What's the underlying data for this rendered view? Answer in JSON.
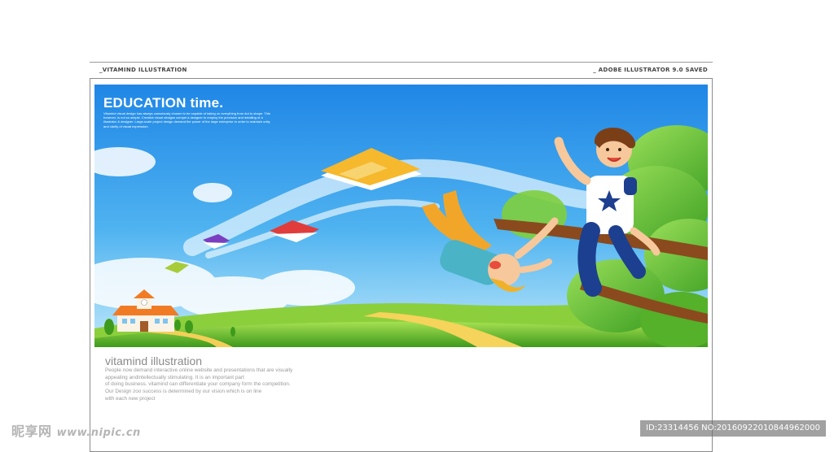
{
  "header": {
    "left_label": "_VITAMIND ILLUSTRATION",
    "right_label": "_ ADOBE ILLUSTRATOR 9.0 SAVED"
  },
  "illustration": {
    "title": "EDUCATION time.",
    "blurb": "Vitamind visual design has always consciously chosen to be capable of taking on everything from dot to shape. This however, is not so simple. Creative visual designs compel a designer to employ the precision and detailing of a illustrator & designer. Large-scale project design demand the power of the large enterprise in order to maintain unity and clarity of visual expression.",
    "colors": {
      "sky_top": "#1f86e6",
      "sky_bottom": "#9fdcf7",
      "grass": "#78c832",
      "path": "#f6d35a",
      "book_yellow": "#f6b82c"
    }
  },
  "footer": {
    "title": "vitamind illustration",
    "lines": [
      "People now demand interactive online website and presentations that are visually",
      "appealing andintellectually stimulating. It is an important part",
      "of doing business. vitamind can differentiate your company form the competition.",
      "Our Design zoo success is determined by our vision which is on line",
      "with each new project"
    ]
  },
  "watermark": {
    "left_brand": "昵享网",
    "left_site": "www.nipic.cn",
    "right_id": "ID:23314456 NO:20160922010844962000"
  }
}
